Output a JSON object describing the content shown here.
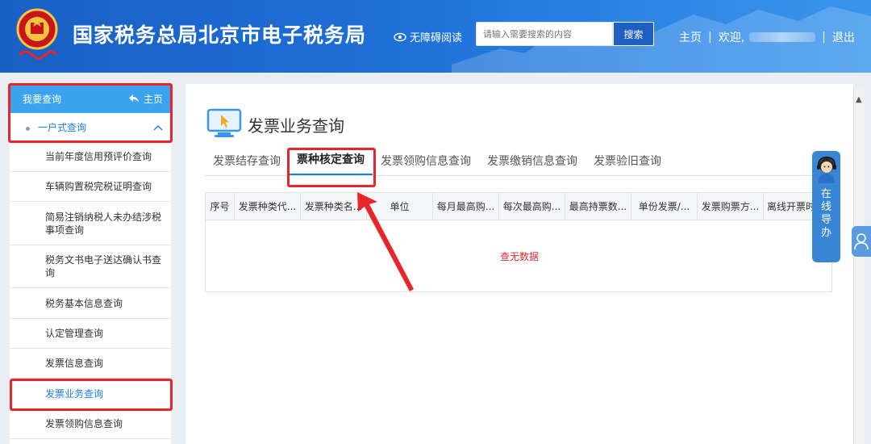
{
  "header": {
    "title": "国家税务总局北京市电子税务局",
    "accessibility_label": "无障碍阅读",
    "search_placeholder": "请输入需要搜索的内容",
    "search_button": "搜索",
    "home_label": "主页",
    "separator": "|",
    "welcome_label": "欢迎,",
    "logout_label": "退出"
  },
  "sidebar": {
    "header_label": "我要查询",
    "home_label": "主页",
    "group_label": "一户式查询",
    "items": [
      {
        "label": "当前年度信用预评价查询"
      },
      {
        "label": "车辆购置税完税证明查询"
      },
      {
        "label": "简易注销纳税人未办结涉税事项查询"
      },
      {
        "label": "税务文书电子送达确认书查询"
      },
      {
        "label": "税务基本信息查询"
      },
      {
        "label": "认定管理查询"
      },
      {
        "label": "发票信息查询"
      },
      {
        "label": "发票业务查询"
      },
      {
        "label": "发票领购信息查询"
      }
    ]
  },
  "main": {
    "title": "发票业务查询",
    "tabs": [
      {
        "label": "发票结存查询"
      },
      {
        "label": "票种核定查询"
      },
      {
        "label": "发票领购信息查询"
      },
      {
        "label": "发票缴销信息查询"
      },
      {
        "label": "发票验旧查询"
      }
    ],
    "active_tab_index": 1,
    "table": {
      "columns": [
        "序号",
        "发票种类代...",
        "发票种类名...",
        "单位",
        "每月最高购...",
        "每次最高购...",
        "最高持票数...",
        "单份发票/...",
        "发票购票方...",
        "离线开票时"
      ],
      "empty_text": "查无数据"
    }
  },
  "guide": {
    "label": "在线导办"
  },
  "colors": {
    "header_blue": "#1e6fd6",
    "sidebar_header": "#3aa3ee",
    "link_blue": "#1f7fe0",
    "highlight_red": "#e8262a"
  }
}
